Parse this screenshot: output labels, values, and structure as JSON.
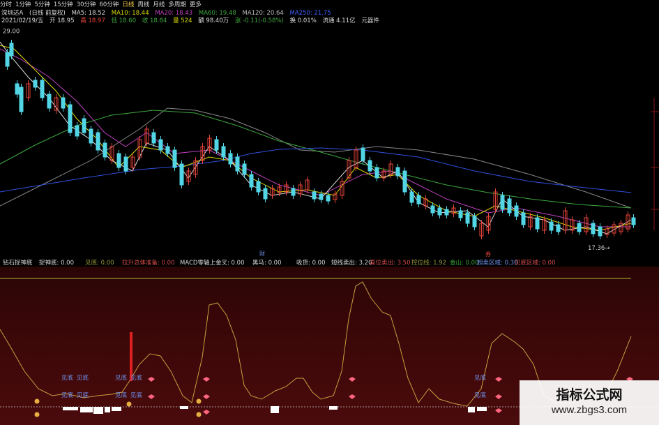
{
  "toolbar": {
    "items": [
      {
        "label": "分时",
        "active": false
      },
      {
        "label": "1分钟",
        "active": false
      },
      {
        "label": "5分钟",
        "active": false
      },
      {
        "label": "15分钟",
        "active": false
      },
      {
        "label": "30分钟",
        "active": false
      },
      {
        "label": "60分钟",
        "active": false
      },
      {
        "label": "日线",
        "active": true
      },
      {
        "label": "周线",
        "active": false
      },
      {
        "label": "月线",
        "active": false
      },
      {
        "label": "多周期",
        "active": false
      },
      {
        "label": "更多",
        "active": false
      }
    ]
  },
  "info_line1": {
    "stock": "深圳达A",
    "period": "(日线 前复权)",
    "ma5": "MA5: 18.52",
    "ma10": "MA10: 18.44",
    "ma20": "MA20: 18.43",
    "ma60": "MA60: 19.48",
    "ma120": "MA120: 20.64",
    "ma_last": "MA250: 21.75"
  },
  "info_line2": {
    "date": "2021/02/19/五",
    "open": "开 18.95",
    "high": "高 18.97",
    "low": "低 18.60",
    "close": "收 18.84",
    "vol": "量 524",
    "amount": "额 98.40万",
    "change": "涨 -0.11(-0.58%)",
    "turnover": "换 0.01%",
    "float": "流通 4.11亿",
    "tool": "元器件"
  },
  "price_labels": {
    "max": "29.00",
    "min": "17.36",
    "marker_a": "财",
    "marker_b": "券"
  },
  "indicator_header": [
    {
      "text": "钻石捉神底",
      "color": "#d8d8d8"
    },
    {
      "text": "捉神底: 0.00",
      "color": "#d8d8d8"
    },
    {
      "text": "见底: 0.00",
      "color": "#9a9a3a"
    },
    {
      "text": "拉升总体准备: 0.00",
      "color": "#d94a4a"
    },
    {
      "text": "MACD零轴上金叉: 0.00",
      "color": "#d8d8d8"
    },
    {
      "text": "黑马: 0.00",
      "color": "#d8d8d8"
    },
    {
      "text": "吸货: 0.00",
      "color": "#d8d8d8"
    },
    {
      "text": "短线卖出: 3.20",
      "color": "#d8d8d8"
    },
    {
      "text": "高位卖出: 3.50",
      "color": "#d94a4a"
    },
    {
      "text": "控位线: 1.92",
      "color": "#9a9a3a"
    },
    {
      "text": "金山: 0.00",
      "color": "#3ea83e"
    },
    {
      "text": "超卖区域: 0.30",
      "color": "#6e8fe8"
    },
    {
      "text": "见底区域: 0.00",
      "color": "#d94a4a"
    }
  ],
  "signal_labels": [
    "见底",
    "见底",
    "见底",
    "见底",
    "见底",
    "见底",
    "见底",
    "见底",
    "见底",
    "见底"
  ],
  "watermark": {
    "title": "指标公式网",
    "url": "www.zbgs3.com"
  },
  "colors": {
    "up": "#e8443a",
    "down": "#52d6e6",
    "ma5": "#dddddd",
    "ma10": "#dcdc00",
    "ma20": "#c040c0",
    "ma60": "#3ea83e",
    "ma120": "#888888",
    "ma250": "#3050e0",
    "oscillator": "#c8a040",
    "grid": "#8a1414"
  }
}
